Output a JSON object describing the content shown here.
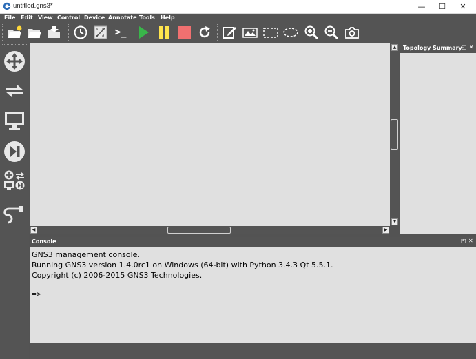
{
  "window": {
    "title": "untitled.gns3*",
    "minimize": "—",
    "maximize": "☐",
    "close": "✕"
  },
  "menu": [
    "File",
    "Edit",
    "View",
    "Control",
    "Device",
    "Annotate",
    "Tools",
    "Help"
  ],
  "toolbar_prompt_glyph": ">_",
  "colors": {
    "chrome": "#545454",
    "canvas": "#e0e0e0",
    "play": "#39b54a",
    "pause": "#ffe44d",
    "stop": "#f07070"
  },
  "left_devices": [
    "routers-icon",
    "switches-icon",
    "end-devices-icon",
    "security-devices-icon",
    "all-devices-icon",
    "add-link-icon"
  ],
  "topology_panel": {
    "title": "Topology Summary",
    "float_glyph": "◰",
    "close_glyph": "✕"
  },
  "console": {
    "title": "Console",
    "float_glyph": "◰",
    "close_glyph": "✕",
    "lines": [
      "GNS3 management console.",
      "Running GNS3 version 1.4.0rc1 on Windows (64-bit) with Python 3.4.3 Qt 5.5.1.",
      "Copyright (c) 2006-2015 GNS3 Technologies."
    ],
    "prompt": "=>"
  }
}
